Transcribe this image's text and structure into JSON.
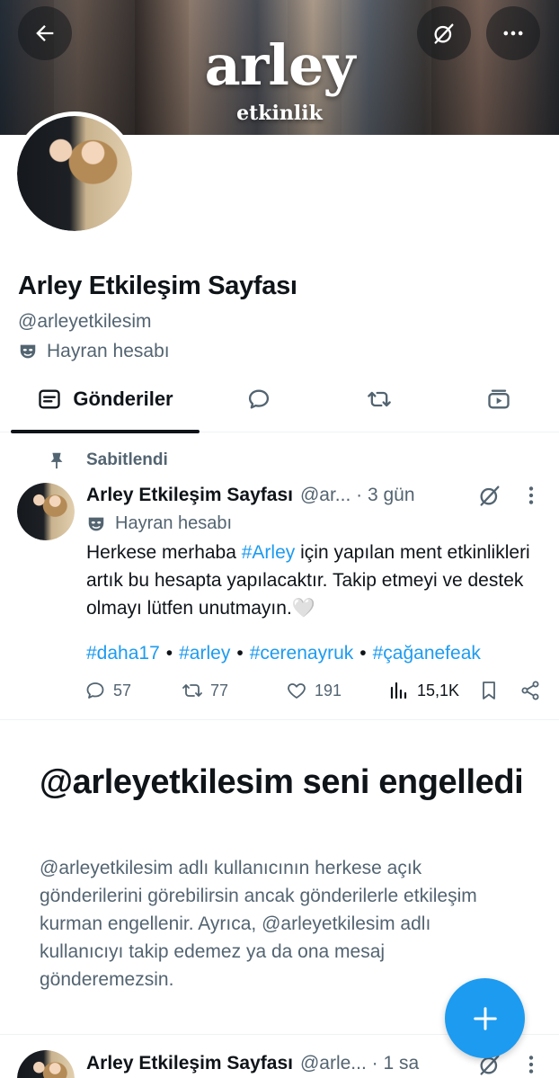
{
  "banner": {
    "title": "arley",
    "subtitle": "etkinlik",
    "back_icon": "arrow-left-icon",
    "grok_icon": "grok-icon",
    "more_icon": "more-horizontal-icon"
  },
  "profile": {
    "display_name": "Arley Etkileşim Sayfası",
    "handle": "@arleyetkilesim",
    "category": "Hayran hesabı",
    "category_icon": "mask-icon"
  },
  "tabs": [
    {
      "label": "Gönderiler",
      "icon": "posts-icon",
      "active": true
    },
    {
      "label": "",
      "icon": "reply-icon",
      "active": false
    },
    {
      "label": "",
      "icon": "repost-icon",
      "active": false
    },
    {
      "label": "",
      "icon": "media-icon",
      "active": false
    }
  ],
  "pinned_tweet": {
    "pinned_label": "Sabitlendi",
    "name": "Arley Etkileşim Sayfası",
    "handle_meta": "@ar... · 3 gün",
    "category": "Hayran hesabı",
    "text_before": "Herkese merhaba ",
    "text_link": "#Arley",
    "text_after": " için yapılan ment etkinlikleri artık bu hesapta yapılacaktır. Takip etmeyi ve destek olmayı lütfen unutmayın.🤍",
    "hashtags": [
      "#daha17",
      "#arley",
      "#cerenayruk",
      "#çağanefeak"
    ],
    "hashtag_separator": "•",
    "stats": {
      "replies": "57",
      "reposts": "77",
      "likes": "191",
      "views": "15,1K"
    }
  },
  "blocked_notice": {
    "title": "@arleyetkilesim seni engelledi",
    "text": "@arleyetkilesim adlı kullanıcının herkese açık gönderilerini görebilirsin ancak gönderilerle etkileşim kurman engellenir. Ayrıca, @arleyetkilesim adlı kullanıcıyı takip edemez ya da ona mesaj gönderemezsin."
  },
  "fab": {
    "icon": "plus-icon"
  },
  "second_tweet": {
    "name": "Arley Etkileşim Sayfası",
    "handle_meta": "@arle... · 1 sa"
  },
  "colors": {
    "accent": "#1d9bf0",
    "text": "#0f1419",
    "secondary": "#536471"
  }
}
